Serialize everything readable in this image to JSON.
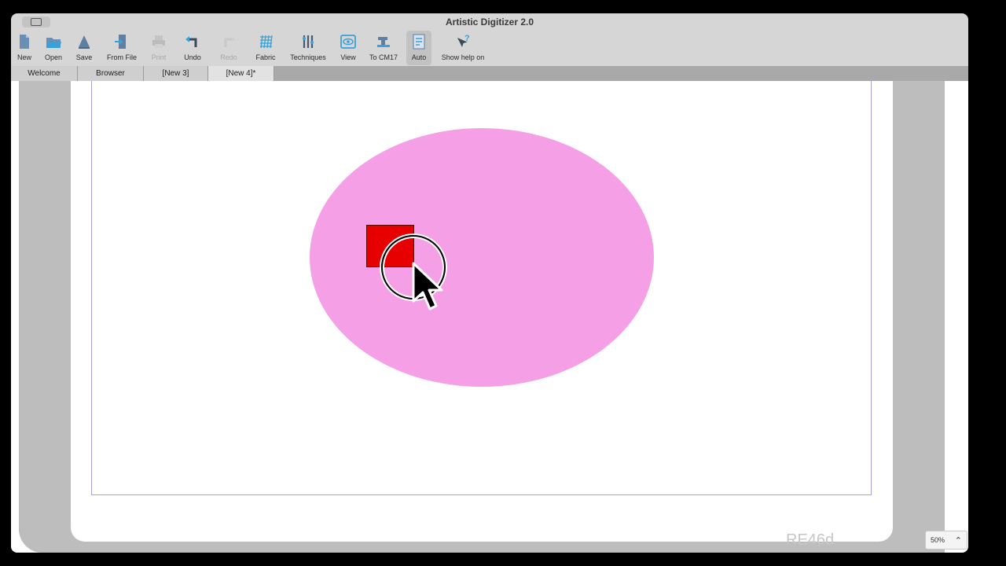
{
  "window": {
    "title": "Artistic Digitizer 2.0"
  },
  "toolbar": {
    "items": [
      {
        "label": "New",
        "icon": "new-document-icon"
      },
      {
        "label": "Open",
        "icon": "folder-open-icon"
      },
      {
        "label": "Save",
        "icon": "save-icon"
      },
      {
        "label": "From File",
        "icon": "import-file-icon"
      },
      {
        "label": "Print",
        "icon": "printer-icon",
        "disabled": true
      },
      {
        "label": "Undo",
        "icon": "undo-icon"
      },
      {
        "label": "Redo",
        "icon": "redo-icon",
        "disabled": true
      },
      {
        "label": "Fabric",
        "icon": "fabric-icon"
      },
      {
        "label": "Techniques",
        "icon": "techniques-icon"
      },
      {
        "label": "View",
        "icon": "view-eye-icon"
      },
      {
        "label": "To CM17",
        "icon": "sewing-machine-icon"
      },
      {
        "label": "Auto",
        "icon": "auto-icon",
        "active": true
      },
      {
        "label": "Show help on",
        "icon": "help-cursor-icon"
      }
    ]
  },
  "tabs": [
    {
      "label": "Welcome"
    },
    {
      "label": "Browser"
    },
    {
      "label": "[New 3]"
    },
    {
      "label": "[New 4]*",
      "active": true
    }
  ],
  "canvas": {
    "shapes": [
      {
        "type": "ellipse",
        "color": "#f5a0e6"
      },
      {
        "type": "rectangle",
        "color": "#e70000"
      }
    ]
  },
  "status": {
    "watermark": "RE46d",
    "zoom": "50%"
  },
  "colors": {
    "accent": "#3aa0d8",
    "hoop_border": "#a7a0d6"
  }
}
